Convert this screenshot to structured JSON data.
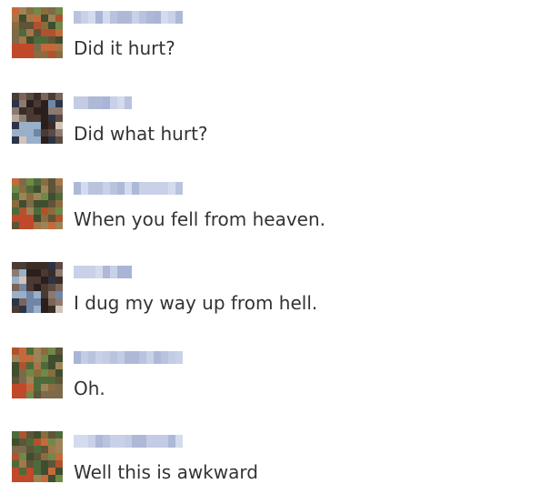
{
  "messages": [
    {
      "sender": "A",
      "text": "Did it hurt?"
    },
    {
      "sender": "B",
      "text": "Did what hurt?"
    },
    {
      "sender": "A",
      "text": "When you fell from heaven."
    },
    {
      "sender": "B",
      "text": "I dug my way up from hell."
    },
    {
      "sender": "A",
      "text": "Oh."
    },
    {
      "sender": "A",
      "text": "Well this is awkward"
    }
  ],
  "colors": {
    "text": "#333333",
    "name_blur": "#b9c3de",
    "avatar_a": "#7a6a4a",
    "avatar_b": "#6e5c54"
  },
  "icons": {
    "avatar_a": "pixelated-profile-photo-icon",
    "avatar_b": "pixelated-profile-photo-icon"
  }
}
